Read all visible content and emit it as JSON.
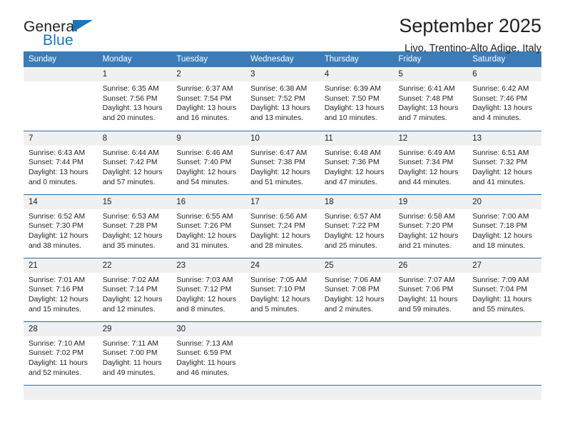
{
  "brand": {
    "name_top": "General",
    "name_bottom": "Blue",
    "accent_color": "#1b75bb"
  },
  "header": {
    "title": "September 2025",
    "subtitle": "Livo, Trentino-Alto Adige, Italy"
  },
  "calendar": {
    "header_bg": "#3b7cb8",
    "rule_color": "#2e6da4",
    "daynum_bg": "#f0f0f0",
    "weekdays": [
      "Sunday",
      "Monday",
      "Tuesday",
      "Wednesday",
      "Thursday",
      "Friday",
      "Saturday"
    ],
    "weeks": [
      [
        {
          "day": ""
        },
        {
          "day": "1",
          "sunrise": "Sunrise: 6:35 AM",
          "sunset": "Sunset: 7:56 PM",
          "daylight1": "Daylight: 13 hours",
          "daylight2": "and 20 minutes."
        },
        {
          "day": "2",
          "sunrise": "Sunrise: 6:37 AM",
          "sunset": "Sunset: 7:54 PM",
          "daylight1": "Daylight: 13 hours",
          "daylight2": "and 16 minutes."
        },
        {
          "day": "3",
          "sunrise": "Sunrise: 6:38 AM",
          "sunset": "Sunset: 7:52 PM",
          "daylight1": "Daylight: 13 hours",
          "daylight2": "and 13 minutes."
        },
        {
          "day": "4",
          "sunrise": "Sunrise: 6:39 AM",
          "sunset": "Sunset: 7:50 PM",
          "daylight1": "Daylight: 13 hours",
          "daylight2": "and 10 minutes."
        },
        {
          "day": "5",
          "sunrise": "Sunrise: 6:41 AM",
          "sunset": "Sunset: 7:48 PM",
          "daylight1": "Daylight: 13 hours",
          "daylight2": "and 7 minutes."
        },
        {
          "day": "6",
          "sunrise": "Sunrise: 6:42 AM",
          "sunset": "Sunset: 7:46 PM",
          "daylight1": "Daylight: 13 hours",
          "daylight2": "and 4 minutes."
        }
      ],
      [
        {
          "day": "7",
          "sunrise": "Sunrise: 6:43 AM",
          "sunset": "Sunset: 7:44 PM",
          "daylight1": "Daylight: 13 hours",
          "daylight2": "and 0 minutes."
        },
        {
          "day": "8",
          "sunrise": "Sunrise: 6:44 AM",
          "sunset": "Sunset: 7:42 PM",
          "daylight1": "Daylight: 12 hours",
          "daylight2": "and 57 minutes."
        },
        {
          "day": "9",
          "sunrise": "Sunrise: 6:46 AM",
          "sunset": "Sunset: 7:40 PM",
          "daylight1": "Daylight: 12 hours",
          "daylight2": "and 54 minutes."
        },
        {
          "day": "10",
          "sunrise": "Sunrise: 6:47 AM",
          "sunset": "Sunset: 7:38 PM",
          "daylight1": "Daylight: 12 hours",
          "daylight2": "and 51 minutes."
        },
        {
          "day": "11",
          "sunrise": "Sunrise: 6:48 AM",
          "sunset": "Sunset: 7:36 PM",
          "daylight1": "Daylight: 12 hours",
          "daylight2": "and 47 minutes."
        },
        {
          "day": "12",
          "sunrise": "Sunrise: 6:49 AM",
          "sunset": "Sunset: 7:34 PM",
          "daylight1": "Daylight: 12 hours",
          "daylight2": "and 44 minutes."
        },
        {
          "day": "13",
          "sunrise": "Sunrise: 6:51 AM",
          "sunset": "Sunset: 7:32 PM",
          "daylight1": "Daylight: 12 hours",
          "daylight2": "and 41 minutes."
        }
      ],
      [
        {
          "day": "14",
          "sunrise": "Sunrise: 6:52 AM",
          "sunset": "Sunset: 7:30 PM",
          "daylight1": "Daylight: 12 hours",
          "daylight2": "and 38 minutes."
        },
        {
          "day": "15",
          "sunrise": "Sunrise: 6:53 AM",
          "sunset": "Sunset: 7:28 PM",
          "daylight1": "Daylight: 12 hours",
          "daylight2": "and 35 minutes."
        },
        {
          "day": "16",
          "sunrise": "Sunrise: 6:55 AM",
          "sunset": "Sunset: 7:26 PM",
          "daylight1": "Daylight: 12 hours",
          "daylight2": "and 31 minutes."
        },
        {
          "day": "17",
          "sunrise": "Sunrise: 6:56 AM",
          "sunset": "Sunset: 7:24 PM",
          "daylight1": "Daylight: 12 hours",
          "daylight2": "and 28 minutes."
        },
        {
          "day": "18",
          "sunrise": "Sunrise: 6:57 AM",
          "sunset": "Sunset: 7:22 PM",
          "daylight1": "Daylight: 12 hours",
          "daylight2": "and 25 minutes."
        },
        {
          "day": "19",
          "sunrise": "Sunrise: 6:58 AM",
          "sunset": "Sunset: 7:20 PM",
          "daylight1": "Daylight: 12 hours",
          "daylight2": "and 21 minutes."
        },
        {
          "day": "20",
          "sunrise": "Sunrise: 7:00 AM",
          "sunset": "Sunset: 7:18 PM",
          "daylight1": "Daylight: 12 hours",
          "daylight2": "and 18 minutes."
        }
      ],
      [
        {
          "day": "21",
          "sunrise": "Sunrise: 7:01 AM",
          "sunset": "Sunset: 7:16 PM",
          "daylight1": "Daylight: 12 hours",
          "daylight2": "and 15 minutes."
        },
        {
          "day": "22",
          "sunrise": "Sunrise: 7:02 AM",
          "sunset": "Sunset: 7:14 PM",
          "daylight1": "Daylight: 12 hours",
          "daylight2": "and 12 minutes."
        },
        {
          "day": "23",
          "sunrise": "Sunrise: 7:03 AM",
          "sunset": "Sunset: 7:12 PM",
          "daylight1": "Daylight: 12 hours",
          "daylight2": "and 8 minutes."
        },
        {
          "day": "24",
          "sunrise": "Sunrise: 7:05 AM",
          "sunset": "Sunset: 7:10 PM",
          "daylight1": "Daylight: 12 hours",
          "daylight2": "and 5 minutes."
        },
        {
          "day": "25",
          "sunrise": "Sunrise: 7:06 AM",
          "sunset": "Sunset: 7:08 PM",
          "daylight1": "Daylight: 12 hours",
          "daylight2": "and 2 minutes."
        },
        {
          "day": "26",
          "sunrise": "Sunrise: 7:07 AM",
          "sunset": "Sunset: 7:06 PM",
          "daylight1": "Daylight: 11 hours",
          "daylight2": "and 59 minutes."
        },
        {
          "day": "27",
          "sunrise": "Sunrise: 7:09 AM",
          "sunset": "Sunset: 7:04 PM",
          "daylight1": "Daylight: 11 hours",
          "daylight2": "and 55 minutes."
        }
      ],
      [
        {
          "day": "28",
          "sunrise": "Sunrise: 7:10 AM",
          "sunset": "Sunset: 7:02 PM",
          "daylight1": "Daylight: 11 hours",
          "daylight2": "and 52 minutes."
        },
        {
          "day": "29",
          "sunrise": "Sunrise: 7:11 AM",
          "sunset": "Sunset: 7:00 PM",
          "daylight1": "Daylight: 11 hours",
          "daylight2": "and 49 minutes."
        },
        {
          "day": "30",
          "sunrise": "Sunrise: 7:13 AM",
          "sunset": "Sunset: 6:59 PM",
          "daylight1": "Daylight: 11 hours",
          "daylight2": "and 46 minutes."
        },
        {
          "day": ""
        },
        {
          "day": ""
        },
        {
          "day": ""
        },
        {
          "day": ""
        }
      ]
    ]
  }
}
